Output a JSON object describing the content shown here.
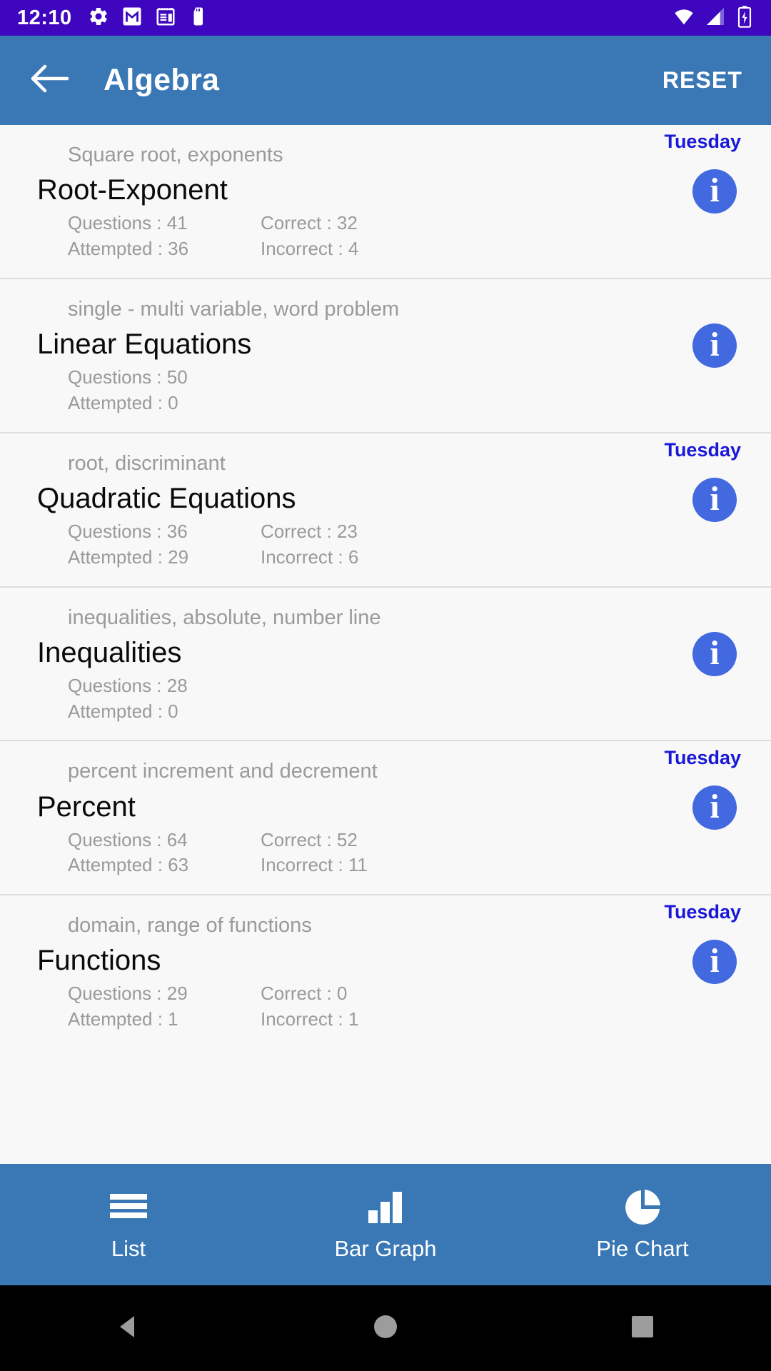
{
  "status_bar": {
    "time": "12:10",
    "left_icons": [
      "settings-gear-icon",
      "gmail-icon",
      "calendar-icon",
      "sd-card-icon"
    ],
    "right_icons": [
      "wifi-icon",
      "signal-icon",
      "battery-charging-icon"
    ],
    "background_color": "#3E06BE"
  },
  "app_bar": {
    "back_icon": "arrow-left-icon",
    "title": "Algebra",
    "reset_label": "RESET",
    "background_color": "#3A78B5"
  },
  "labels": {
    "questions": "Questions :",
    "attempted": "Attempted :",
    "correct": "Correct :",
    "incorrect": "Incorrect :",
    "info_glyph": "i",
    "day_color": "#1A18D8",
    "info_color": "#4369E0"
  },
  "topics": [
    {
      "day": "Tuesday",
      "subtitle": "Square root, exponents",
      "title": "Root-Exponent",
      "questions": "Questions : 41",
      "attempted": "Attempted : 36",
      "correct": "Correct : 32",
      "incorrect": "Incorrect : 4"
    },
    {
      "day": "",
      "subtitle": "single - multi variable, word problem",
      "title": "Linear Equations",
      "questions": "Questions : 50",
      "attempted": "Attempted : 0",
      "correct": "",
      "incorrect": ""
    },
    {
      "day": "Tuesday",
      "subtitle": "root, discriminant",
      "title": "Quadratic Equations",
      "questions": "Questions : 36",
      "attempted": "Attempted : 29",
      "correct": "Correct : 23",
      "incorrect": "Incorrect : 6"
    },
    {
      "day": "",
      "subtitle": "inequalities, absolute, number line",
      "title": "Inequalities",
      "questions": "Questions : 28",
      "attempted": "Attempted : 0",
      "correct": "",
      "incorrect": ""
    },
    {
      "day": "Tuesday",
      "subtitle": "percent increment and decrement",
      "title": "Percent",
      "questions": "Questions : 64",
      "attempted": "Attempted : 63",
      "correct": "Correct : 52",
      "incorrect": "Incorrect : 11"
    },
    {
      "day": "Tuesday",
      "subtitle": "domain, range of functions",
      "title": "Functions",
      "questions": "Questions : 29",
      "attempted": "Attempted : 1",
      "correct": "Correct : 0",
      "incorrect": "Incorrect : 1"
    }
  ],
  "bottom_nav": {
    "tabs": [
      {
        "icon": "list-icon",
        "label": "List"
      },
      {
        "icon": "bar-graph-icon",
        "label": "Bar Graph"
      },
      {
        "icon": "pie-chart-icon",
        "label": "Pie Chart"
      }
    ],
    "background_color": "#3A78B5"
  },
  "system_nav": {
    "back_icon": "triangle-back-icon",
    "home_icon": "circle-home-icon",
    "recents_icon": "square-recents-icon"
  }
}
